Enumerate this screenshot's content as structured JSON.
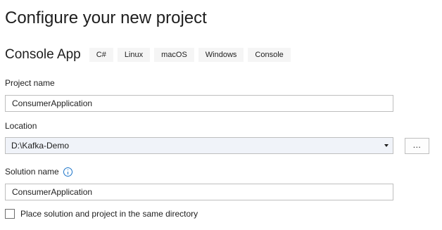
{
  "page": {
    "title": "Configure your new project"
  },
  "template": {
    "name": "Console App",
    "tags": [
      "C#",
      "Linux",
      "macOS",
      "Windows",
      "Console"
    ]
  },
  "project_name": {
    "label": "Project name",
    "value": "ConsumerApplication"
  },
  "location": {
    "label": "Location",
    "value": "D:\\Kafka-Demo",
    "browse_label": "..."
  },
  "solution_name": {
    "label": "Solution name",
    "info_icon": "info-icon",
    "value": "ConsumerApplication"
  },
  "same_directory": {
    "label": "Place solution and project in the same directory",
    "checked": false
  },
  "colors": {
    "accent": "#1a73c8",
    "border": "#bebebe",
    "tag_background": "#f5f5f5"
  }
}
